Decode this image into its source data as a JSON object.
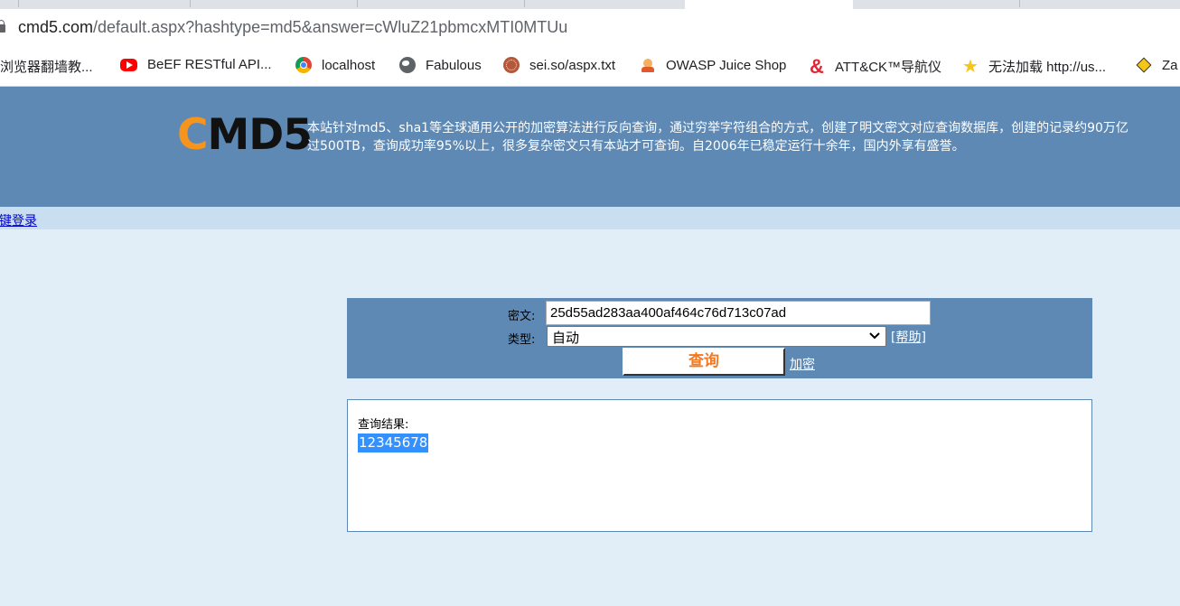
{
  "browser": {
    "url": {
      "host": "cmd5.com",
      "path": "/default.aspx?hashtype=md5&answer=cWluZ21pbmcxMTI0MTUu"
    },
    "bookmarks": [
      {
        "label": "浏览器翻墙教...",
        "icon": "none"
      },
      {
        "label": "BeEF RESTful API...",
        "icon": "youtube-icon"
      },
      {
        "label": "localhost",
        "icon": "chrome-icon"
      },
      {
        "label": "Fabulous",
        "icon": "globe-icon"
      },
      {
        "label": "sei.so/aspx.txt",
        "icon": "ball-icon"
      },
      {
        "label": "OWASP Juice Shop",
        "icon": "juice-icon"
      },
      {
        "label": "ATT&CK™导航仪",
        "icon": "ampersand-icon"
      },
      {
        "label": "无法加载 http://us...",
        "icon": "star-icon"
      },
      {
        "label": "Za",
        "icon": "diamond-icon"
      }
    ]
  },
  "site": {
    "logo": {
      "first": "C",
      "rest": "MD5"
    },
    "intro_line1": "本站针对md5、sha1等全球通用公开的加密算法进行反向查询，通过穷举字符组合的方式，创建了明文密文对应查询数据库，创建的记录约90万亿",
    "intro_line2": "过500TB，查询成功率95%以上，很多复杂密文只有本站才可查询。自2006年已稳定运行十余年，国内外享有盛誉。",
    "login_link": "键登录"
  },
  "form": {
    "cipher_label": "密文:",
    "cipher_value": "25d55ad283aa400af464c76d713c07ad",
    "type_label": "类型:",
    "type_selected": "自动",
    "help_link": "[帮助]",
    "query_button": "查询",
    "encrypt_link": "加密"
  },
  "result": {
    "label": "查询结果:",
    "value": "12345678"
  },
  "colors": {
    "header_bg": "#5d89b4",
    "page_bg": "#e2eef7",
    "login_strip_bg": "#c9def0",
    "logo_accent": "#f7941d",
    "query_button_text": "#f47920",
    "selection": "#3390ff"
  }
}
